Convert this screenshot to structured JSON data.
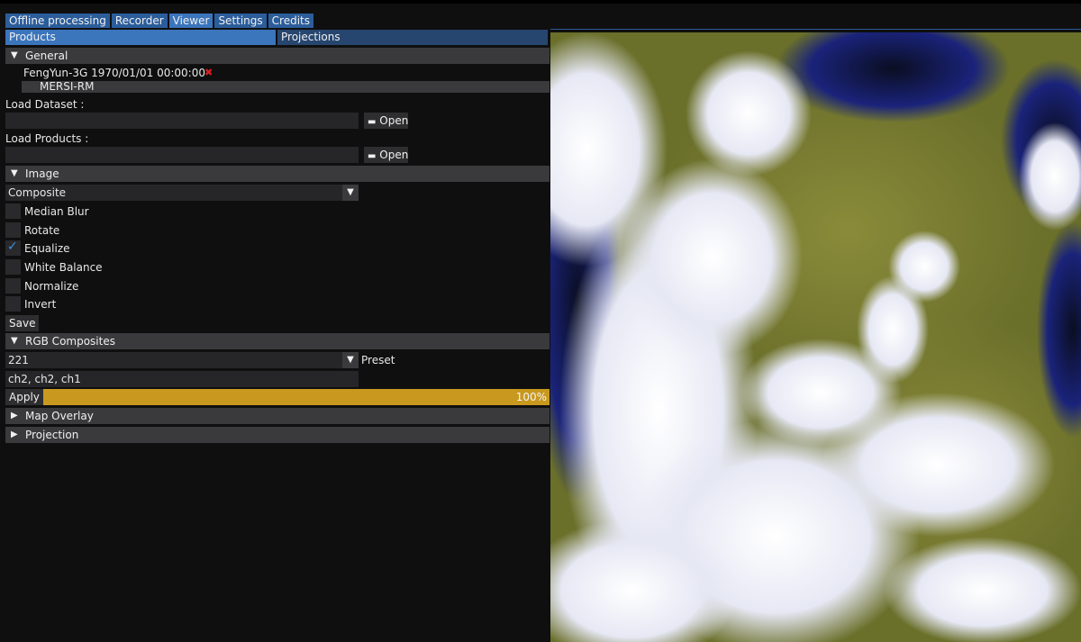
{
  "tabs": [
    "Offline processing",
    "Recorder",
    "Viewer",
    "Settings",
    "Credits"
  ],
  "subtabs": [
    "Products",
    "Projections"
  ],
  "general": {
    "header": "General",
    "product_name": "FengYun-3G 1970/01/01 00:00:00",
    "delete_icon": "✖",
    "instrument": "MERSI-RM"
  },
  "load_dataset": {
    "label": "Load Dataset :",
    "value": "",
    "button": "Open"
  },
  "load_products": {
    "label": "Load Products :",
    "value": "",
    "button": "Open"
  },
  "image": {
    "header": "Image",
    "mode": "Composite",
    "options": [
      {
        "label": "Median Blur",
        "checked": false
      },
      {
        "label": "Rotate",
        "checked": false
      },
      {
        "label": "Equalize",
        "checked": true
      },
      {
        "label": "White Balance",
        "checked": false
      },
      {
        "label": "Normalize",
        "checked": false
      },
      {
        "label": "Invert",
        "checked": false
      }
    ],
    "save_label": "Save"
  },
  "rgb": {
    "header": "RGB Composites",
    "preset_value": "221",
    "preset_label": "Preset",
    "expression": "ch2, ch2, ch1",
    "apply_label": "Apply",
    "progress_text": "100%",
    "progress_fraction": 1.0
  },
  "map_overlay": {
    "header": "Map Overlay"
  },
  "projection": {
    "header": "Projection"
  },
  "colors": {
    "accent": "#3b75bc",
    "progress": "#c8981f",
    "delete": "#e02020"
  }
}
